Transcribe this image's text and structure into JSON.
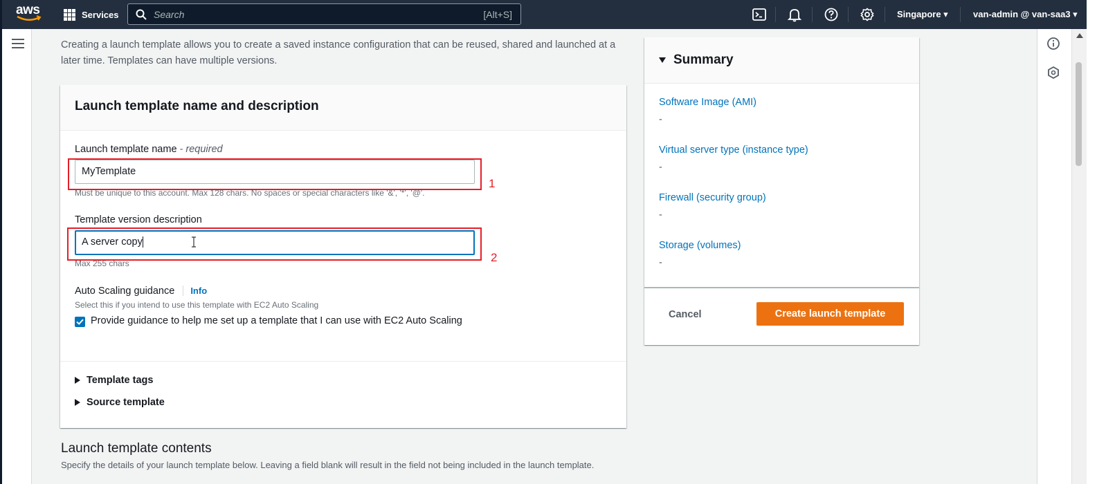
{
  "topnav": {
    "logo_text": "aws",
    "services_label": "Services",
    "search_placeholder": "Search",
    "search_shortcut": "[Alt+S]",
    "region": "Singapore ▾",
    "account": "van-admin @ van-saa3 ▾",
    "icons": [
      "cloudshell-icon",
      "bell-icon",
      "help-icon",
      "gear-icon"
    ]
  },
  "page": {
    "intro": "Creating a launch template allows you to create a saved instance configuration that can be reused, shared and launched at a later time. Templates can have multiple versions."
  },
  "name_section": {
    "title": "Launch template name and description",
    "name_label": "Launch template name",
    "name_required": "- required",
    "name_value": "MyTemplate",
    "name_hint": "Must be unique to this account. Max 128 chars. No spaces or special characters like '&', '*', '@'.",
    "desc_label": "Template version description",
    "desc_value": "A server copy",
    "desc_hint": "Max 255 chars",
    "asg_label": "Auto Scaling guidance",
    "asg_info": "Info",
    "asg_hint": "Select this if you intend to use this template with EC2 Auto Scaling",
    "asg_checkbox_label": "Provide guidance to help me set up a template that I can use with EC2 Auto Scaling",
    "asg_checked": true,
    "expanders": [
      "Template tags",
      "Source template"
    ]
  },
  "annotations": [
    "1",
    "2"
  ],
  "contents_section": {
    "title": "Launch template contents",
    "desc": "Specify the details of your launch template below. Leaving a field blank will result in the field not being included in the launch template."
  },
  "summary": {
    "title": "Summary",
    "items": [
      {
        "label": "Software Image (AMI)",
        "value": "-"
      },
      {
        "label": "Virtual server type (instance type)",
        "value": "-"
      },
      {
        "label": "Firewall (security group)",
        "value": "-"
      },
      {
        "label": "Storage (volumes)",
        "value": "-"
      }
    ],
    "cancel_label": "Cancel",
    "create_label": "Create launch template"
  },
  "colors": {
    "nav_bg": "#232f3e",
    "primary_button": "#ec7211",
    "link": "#0073bb",
    "annotation": "#e41e26"
  }
}
